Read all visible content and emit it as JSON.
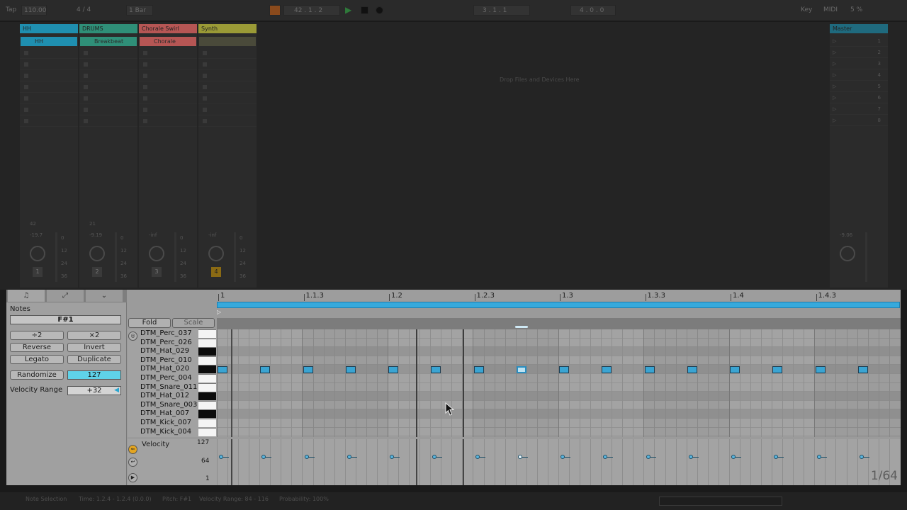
{
  "topbar": {
    "tap": "Tap",
    "tempo": "110.00",
    "time_sig": "4 / 4",
    "quantize": "1 Bar",
    "position": "42 . 1 . 2",
    "loop_start": "3 . 1 . 1",
    "loop_length": "4 . 0 . 0",
    "key": "Key",
    "midi": "MIDI",
    "cpu": "5 %"
  },
  "tracks": [
    {
      "name": "HH",
      "clip": "HH",
      "color": "#1f8fb0",
      "vol": "-19.7",
      "num": "1",
      "ctrl": "42"
    },
    {
      "name": "DRUMS",
      "clip": "Breakbeat",
      "color": "#2f8f78",
      "vol": "-9.19",
      "num": "2",
      "ctrl": "21"
    },
    {
      "name": "Chorale Swirl",
      "clip": "Chorale",
      "color": "#b65654",
      "vol": "-inf",
      "num": "3",
      "ctrl": ""
    },
    {
      "name": "Synth",
      "clip": "",
      "color": "#9a9a36",
      "vol": "-inf",
      "num": "4",
      "ctrl": ""
    }
  ],
  "master": {
    "name": "Master",
    "vol": "-9.06",
    "scenes": [
      "1",
      "2",
      "3",
      "4",
      "5",
      "6",
      "7",
      "8"
    ]
  },
  "drop_message": "Drop Files and Devices Here",
  "meter_scale": [
    "0",
    "12",
    "24",
    "36"
  ],
  "editor": {
    "notes_title": "Notes",
    "pitch": "F#1",
    "btn_half": "÷2",
    "btn_double": "×2",
    "btn_reverse": "Reverse",
    "btn_invert": "Invert",
    "btn_legato": "Legato",
    "btn_duplicate": "Duplicate",
    "btn_randomize": "Randomize",
    "randomize_value": "127",
    "velocity_range_label": "Velocity Range",
    "velocity_range_value": "+32",
    "fold": "Fold",
    "scale": "Scale",
    "keys": [
      {
        "name": "DTM_Perc_037",
        "black": false
      },
      {
        "name": "DTM_Perc_026",
        "black": false
      },
      {
        "name": "DTM_Hat_029",
        "black": true
      },
      {
        "name": "DTM_Perc_010",
        "black": false
      },
      {
        "name": "DTM_Hat_020",
        "black": true
      },
      {
        "name": "DTM_Perc_004",
        "black": false
      },
      {
        "name": "DTM_Snare_011",
        "black": false
      },
      {
        "name": "DTM_Hat_012",
        "black": true
      },
      {
        "name": "DTM_Snare_003",
        "black": false
      },
      {
        "name": "DTM_Hat_007",
        "black": true
      },
      {
        "name": "DTM_Kick_007",
        "black": false
      },
      {
        "name": "DTM_Kick_004",
        "black": false
      }
    ],
    "ruler": [
      "1",
      "1.1.3",
      "1.2",
      "1.2.3",
      "1.3",
      "1.3.3",
      "1.4",
      "1.4.3"
    ],
    "velocity_label": "Velocity",
    "vel_max": "127",
    "vel_mid": "64",
    "vel_min": "1",
    "grid_size": "1/64",
    "note_count": 16,
    "selected_note_index": 7
  },
  "statusbar": {
    "selection": "Note Selection",
    "time": "Time: 1.2.4 - 1.2.4 (0.0.0)",
    "pitch": "Pitch: F#1",
    "velocity_range": "Velocity Range: 84 - 116",
    "probability": "Probability: 100%"
  }
}
